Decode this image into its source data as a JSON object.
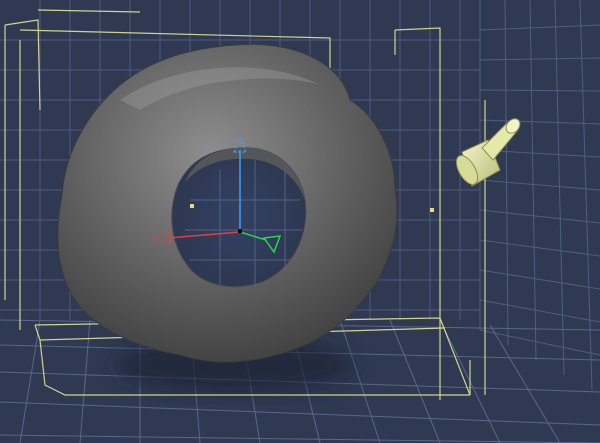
{
  "viewport": {
    "colors": {
      "background": "#2f3a52",
      "grid_line": "#5b6b8a",
      "bounding_box": "#e8e89a",
      "torus_dark": "#4a4a4a",
      "torus_light": "#8a8a8a",
      "axis_x": "#e04040",
      "axis_y": "#3aa0ff",
      "axis_z": "#30d050",
      "light_fixture": "#e6e8a8"
    },
    "objects": [
      "torus-mesh",
      "transform-gizmo",
      "spot-light",
      "bounding-box"
    ]
  }
}
